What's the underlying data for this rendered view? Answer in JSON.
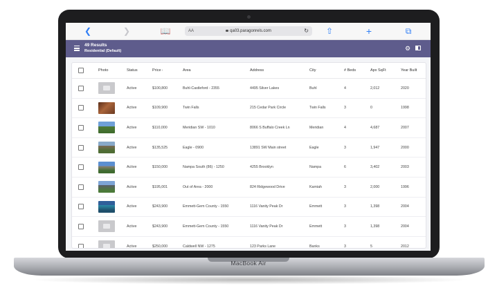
{
  "device": {
    "brand": "MacBook Air"
  },
  "browser": {
    "text_size_label": "AA",
    "url": "qa03.paragonrels.com"
  },
  "header": {
    "results_label": "49 Results",
    "search_name": "Residential (Default)"
  },
  "table": {
    "columns": [
      "Photo",
      "Status",
      "Price",
      "Area",
      "Address",
      "City",
      "# Beds",
      "Apx SqFt",
      "Year Built"
    ],
    "sort_indicator": "↑",
    "rows": [
      {
        "photo": "none",
        "status": "Active",
        "price": "$100,800",
        "area": "Buhl-Castleford - 2355",
        "address": "4495 Silver Lakes",
        "city": "Buhl",
        "beds": "4",
        "sqft": "2,012",
        "year": "2020"
      },
      {
        "photo": "wood",
        "status": "Active",
        "price": "$109,900",
        "area": "Twin Falls",
        "address": "215 Cedar Park Circle",
        "city": "Twin Falls",
        "beds": "3",
        "sqft": "0",
        "year": "1998"
      },
      {
        "photo": "house1",
        "status": "Active",
        "price": "$110,000",
        "area": "Meridian SW - 1010",
        "address": "8066 S Buffalo Creek Ln",
        "city": "Meridian",
        "beds": "4",
        "sqft": "4,687",
        "year": "2007"
      },
      {
        "photo": "house2",
        "status": "Active",
        "price": "$135,525",
        "area": "Eagle - 0900",
        "address": "13891 SW Main street",
        "city": "Eagle",
        "beds": "3",
        "sqft": "1,947",
        "year": "2000"
      },
      {
        "photo": "house3",
        "status": "Active",
        "price": "$150,000",
        "area": "Nampa South (86) - 1250",
        "address": "4255 Brooklyn",
        "city": "Nampa",
        "beds": "6",
        "sqft": "3,402",
        "year": "2003"
      },
      {
        "photo": "house4",
        "status": "Active",
        "price": "$195,001",
        "area": "Out of Area - 2000",
        "address": "824 Ridgewood Drive",
        "city": "Kamiah",
        "beds": "3",
        "sqft": "2,000",
        "year": "1996"
      },
      {
        "photo": "house5",
        "status": "Active",
        "price": "$243,900",
        "area": "Emmett-Gem County - 1550",
        "address": "1116 Vanity Peak Dr",
        "city": "Emmett",
        "beds": "3",
        "sqft": "1,398",
        "year": "2004"
      },
      {
        "photo": "none",
        "status": "Active",
        "price": "$243,900",
        "area": "Emmett-Gem County - 1550",
        "address": "1116 Vanity Peak Dr",
        "city": "Emmett",
        "beds": "3",
        "sqft": "1,398",
        "year": "2004"
      },
      {
        "photo": "none",
        "status": "Active",
        "price": "$250,000",
        "area": "Caldwell NW - 1275",
        "address": "123 Parks Lane",
        "city": "Banks",
        "beds": "3",
        "sqft": "5",
        "year": "2012"
      }
    ]
  },
  "colors": {
    "app_bar": "#5e5c8c",
    "safari_accent": "#2f7ef6",
    "device_frame": "#1d1d1f"
  },
  "icons": [
    "back-chevron-icon",
    "forward-chevron-icon",
    "bookmarks-icon",
    "lock-icon",
    "reload-icon",
    "share-icon",
    "new-tab-icon",
    "tabs-icon",
    "hamburger-menu-icon",
    "gear-icon",
    "panel-icon"
  ]
}
